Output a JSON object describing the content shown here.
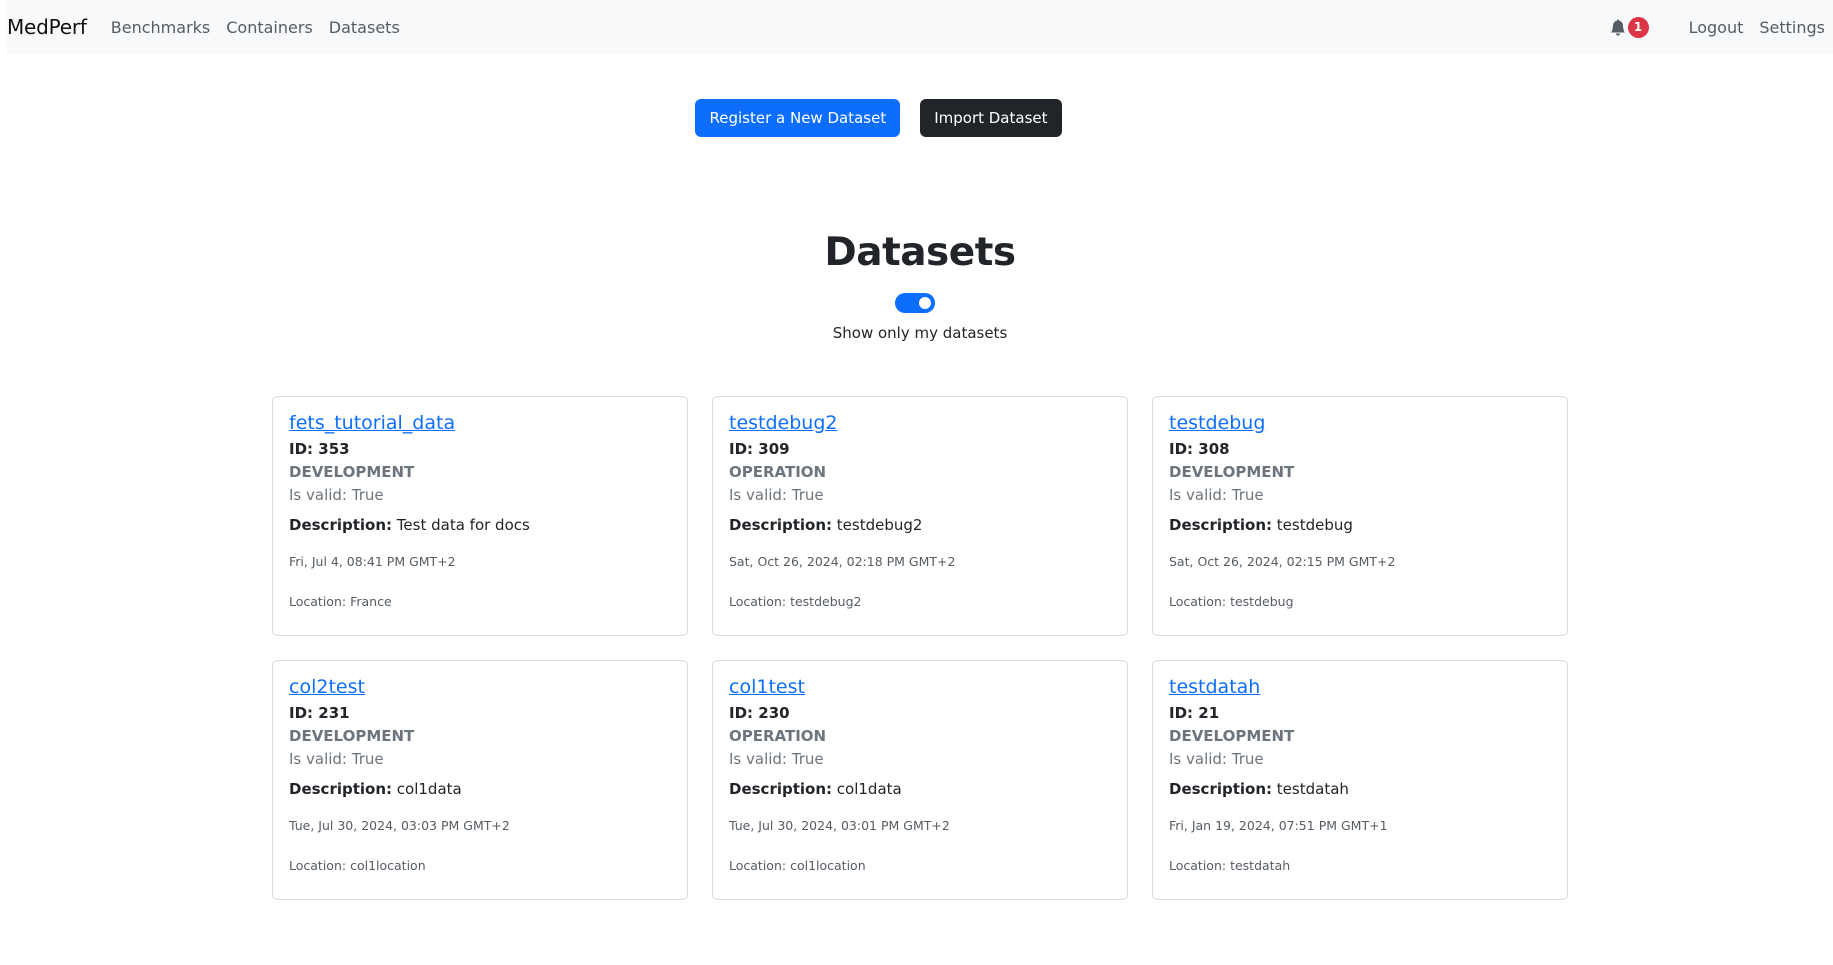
{
  "navbar": {
    "brand": "MedPerf",
    "links": [
      "Benchmarks",
      "Containers",
      "Datasets"
    ],
    "notification_count": "1",
    "logout": "Logout",
    "settings": "Settings"
  },
  "actions": {
    "register": "Register a New Dataset",
    "import": "Import Dataset"
  },
  "main": {
    "title": "Datasets",
    "toggle_label": "Show only my datasets",
    "toggle_on": true
  },
  "labels": {
    "id_prefix": "ID:",
    "valid_prefix": "Is valid:",
    "description_prefix": "Description:",
    "location_prefix": "Location:"
  },
  "datasets": [
    {
      "name": "fets_tutorial_data",
      "id": "353",
      "state": "DEVELOPMENT",
      "valid": "True",
      "description": "Test data for docs",
      "date": "Fri, Jul 4, 08:41 PM GMT+2",
      "location": "France"
    },
    {
      "name": "testdebug2",
      "id": "309",
      "state": "OPERATION",
      "valid": "True",
      "description": "testdebug2",
      "date": "Sat, Oct 26, 2024, 02:18 PM GMT+2",
      "location": "testdebug2"
    },
    {
      "name": "testdebug",
      "id": "308",
      "state": "DEVELOPMENT",
      "valid": "True",
      "description": "testdebug",
      "date": "Sat, Oct 26, 2024, 02:15 PM GMT+2",
      "location": "testdebug"
    },
    {
      "name": "col2test",
      "id": "231",
      "state": "DEVELOPMENT",
      "valid": "True",
      "description": "col1data",
      "date": "Tue, Jul 30, 2024, 03:03 PM GMT+2",
      "location": "col1location"
    },
    {
      "name": "col1test",
      "id": "230",
      "state": "OPERATION",
      "valid": "True",
      "description": "col1data",
      "date": "Tue, Jul 30, 2024, 03:01 PM GMT+2",
      "location": "col1location"
    },
    {
      "name": "testdatah",
      "id": "21",
      "state": "DEVELOPMENT",
      "valid": "True",
      "description": "testdatah",
      "date": "Fri, Jan 19, 2024, 07:51 PM GMT+1",
      "location": "testdatah"
    }
  ],
  "icons": {
    "bell": "bell-icon"
  },
  "colors": {
    "primary": "#0d6efd",
    "dark": "#212529",
    "badge": "#dc3545",
    "navbar_bg": "#f8f9fa"
  }
}
